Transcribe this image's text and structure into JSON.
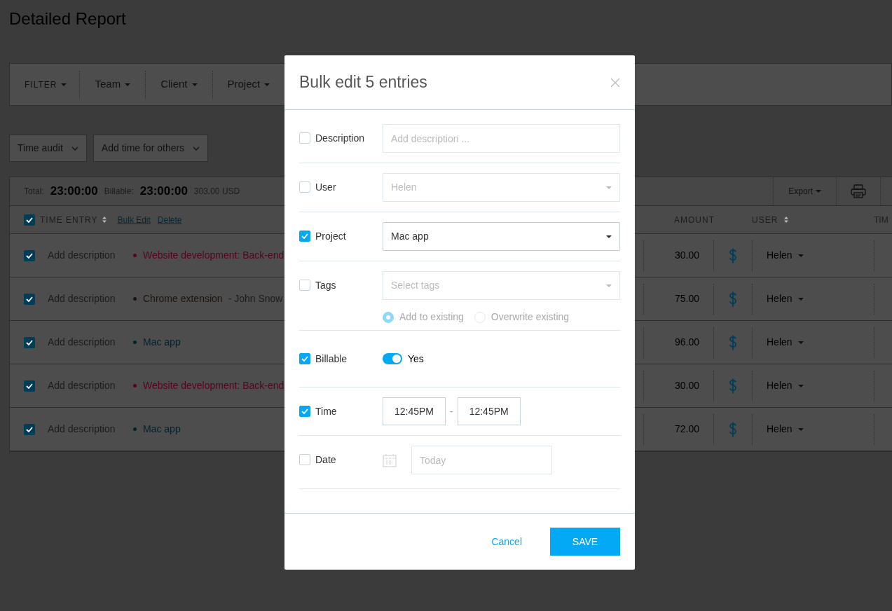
{
  "page": {
    "title": "Detailed Report"
  },
  "filters": [
    {
      "label": "FILTER",
      "kind": "main"
    },
    {
      "label": "Team",
      "kind": "dropdown"
    },
    {
      "label": "Client",
      "kind": "dropdown"
    },
    {
      "label": "Project",
      "kind": "dropdown"
    }
  ],
  "actions": [
    "Time audit",
    "Add time for others"
  ],
  "summary": {
    "total_label": "Total:",
    "total": "23:00:00",
    "billable_label": "Billable:",
    "billable": "23:00:00",
    "amount": "303.00 USD",
    "export": "Export"
  },
  "table": {
    "all_checked": true,
    "columns": [
      "TIME ENTRY",
      "AMOUNT",
      "USER",
      "TIM"
    ],
    "bulk_edit": "Bulk Edit",
    "delete": "Delete",
    "rows": [
      {
        "checked": true,
        "description": "Add description",
        "project": "Website development: Back-end",
        "color": "#5a0020",
        "amount": "30.00",
        "user": "Helen"
      },
      {
        "checked": true,
        "description": "Add description",
        "project": "Chrome extension",
        "client": "- John Snow",
        "color": "#1e1410",
        "amount": "75.00",
        "user": "Helen"
      },
      {
        "checked": true,
        "description": "Add description",
        "project": "Mac app",
        "color": "#00242a",
        "amount": "96.00",
        "user": "Helen"
      },
      {
        "checked": true,
        "description": "Add description",
        "project": "Website development: Back-end",
        "color": "#5a0020",
        "amount": "30.00",
        "user": "Helen"
      },
      {
        "checked": true,
        "description": "Add description",
        "project": "Mac app",
        "color": "#00242a",
        "amount": "72.00",
        "user": "Helen"
      }
    ]
  },
  "modal": {
    "title": "Bulk edit 5 entries",
    "fields": [
      {
        "kind": "text",
        "label": "Description",
        "checked": false,
        "placeholder": "Add description ..."
      },
      {
        "kind": "select",
        "label": "User",
        "checked": false,
        "value": "Helen"
      },
      {
        "kind": "select",
        "label": "Project",
        "checked": true,
        "value": "Mac app"
      },
      {
        "kind": "tags",
        "label": "Tags",
        "checked": false,
        "placeholder": "Select tags",
        "options": [
          {
            "label": "Add to existing",
            "selected": true
          },
          {
            "label": "Overwrite existing",
            "selected": false
          }
        ]
      },
      {
        "kind": "toggle",
        "label": "Billable",
        "checked": true,
        "on": true,
        "text": "Yes"
      },
      {
        "kind": "timerange",
        "label": "Time",
        "checked": true,
        "start": "12:45PM",
        "separator": "-",
        "end": "12:45PM"
      },
      {
        "kind": "date",
        "label": "Date",
        "checked": false,
        "placeholder": "Today"
      }
    ],
    "cancel": "Cancel",
    "save": "SAVE"
  }
}
